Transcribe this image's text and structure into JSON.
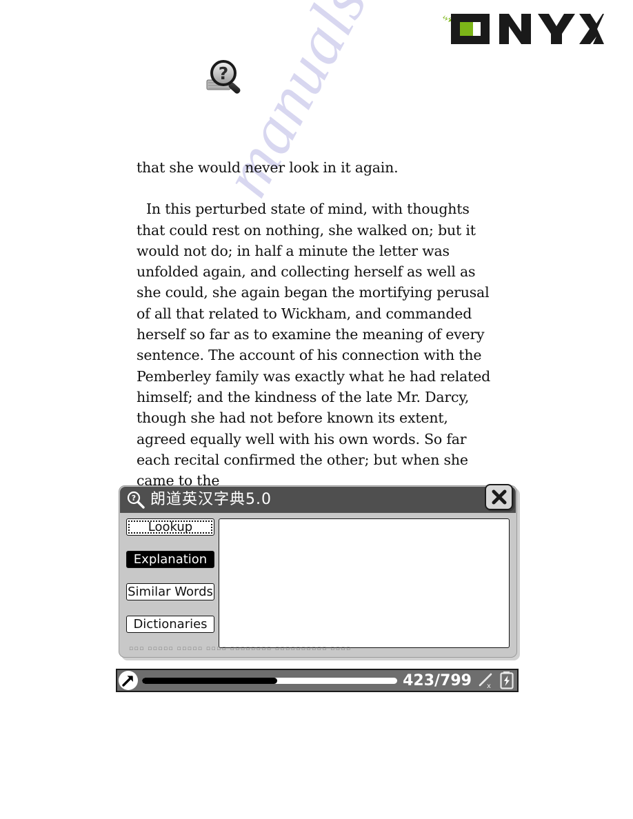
{
  "brand": {
    "logo_text": "ONYX",
    "logo_accent_color": "#7cb518",
    "logo_dark_color": "#1a1a1a"
  },
  "watermark": {
    "text": "manualsnive.com"
  },
  "toolbar": {
    "help_icon_name": "magnifier-question-icon"
  },
  "book": {
    "paragraphs": [
      "that she would never look in it again.",
      "In this perturbed state of mind, with thoughts that could rest on nothing, she walked on; but it would not do; in half a minute the letter was unfolded again, and collecting herself as well as she could, she again began the mortifying perusal of all that related to Wickham, and commanded herself so far as to examine the meaning of every sentence. The account of his connection with the Pemberley family was exactly what he had related himself; and the kindness of the late Mr. Darcy, though she had not before known its extent, agreed equally well with his own words. So far each recital confirmed the other; but when she came to the"
    ]
  },
  "dictionary": {
    "title": "朗道英汉字典5.0",
    "title_icon": "magnifier-question-icon",
    "close_label": "✕",
    "tabs": [
      {
        "label": "Lookup",
        "state": "focused"
      },
      {
        "label": "Explanation",
        "state": "selected"
      },
      {
        "label": "Similar Words",
        "state": "normal"
      },
      {
        "label": "Dictionaries",
        "state": "normal"
      }
    ],
    "content_text": "",
    "footer_text": "▫▫▫  ▫▫▫▫▫  ▫▫▫▫▫  ▫▫▫▫  ▫▫▫▫▫▫▫▫  ▫▫▫▫▫▫▫▫▫▫  ▫▫▫▫"
  },
  "statusbar": {
    "nav_icon": "arrow-up-right-icon",
    "page_indicator": "423/799",
    "current_page": 423,
    "total_pages": 799,
    "progress_percent": 53,
    "pen_icon": "stylus-disabled-icon",
    "battery_icon": "battery-charging-icon"
  }
}
